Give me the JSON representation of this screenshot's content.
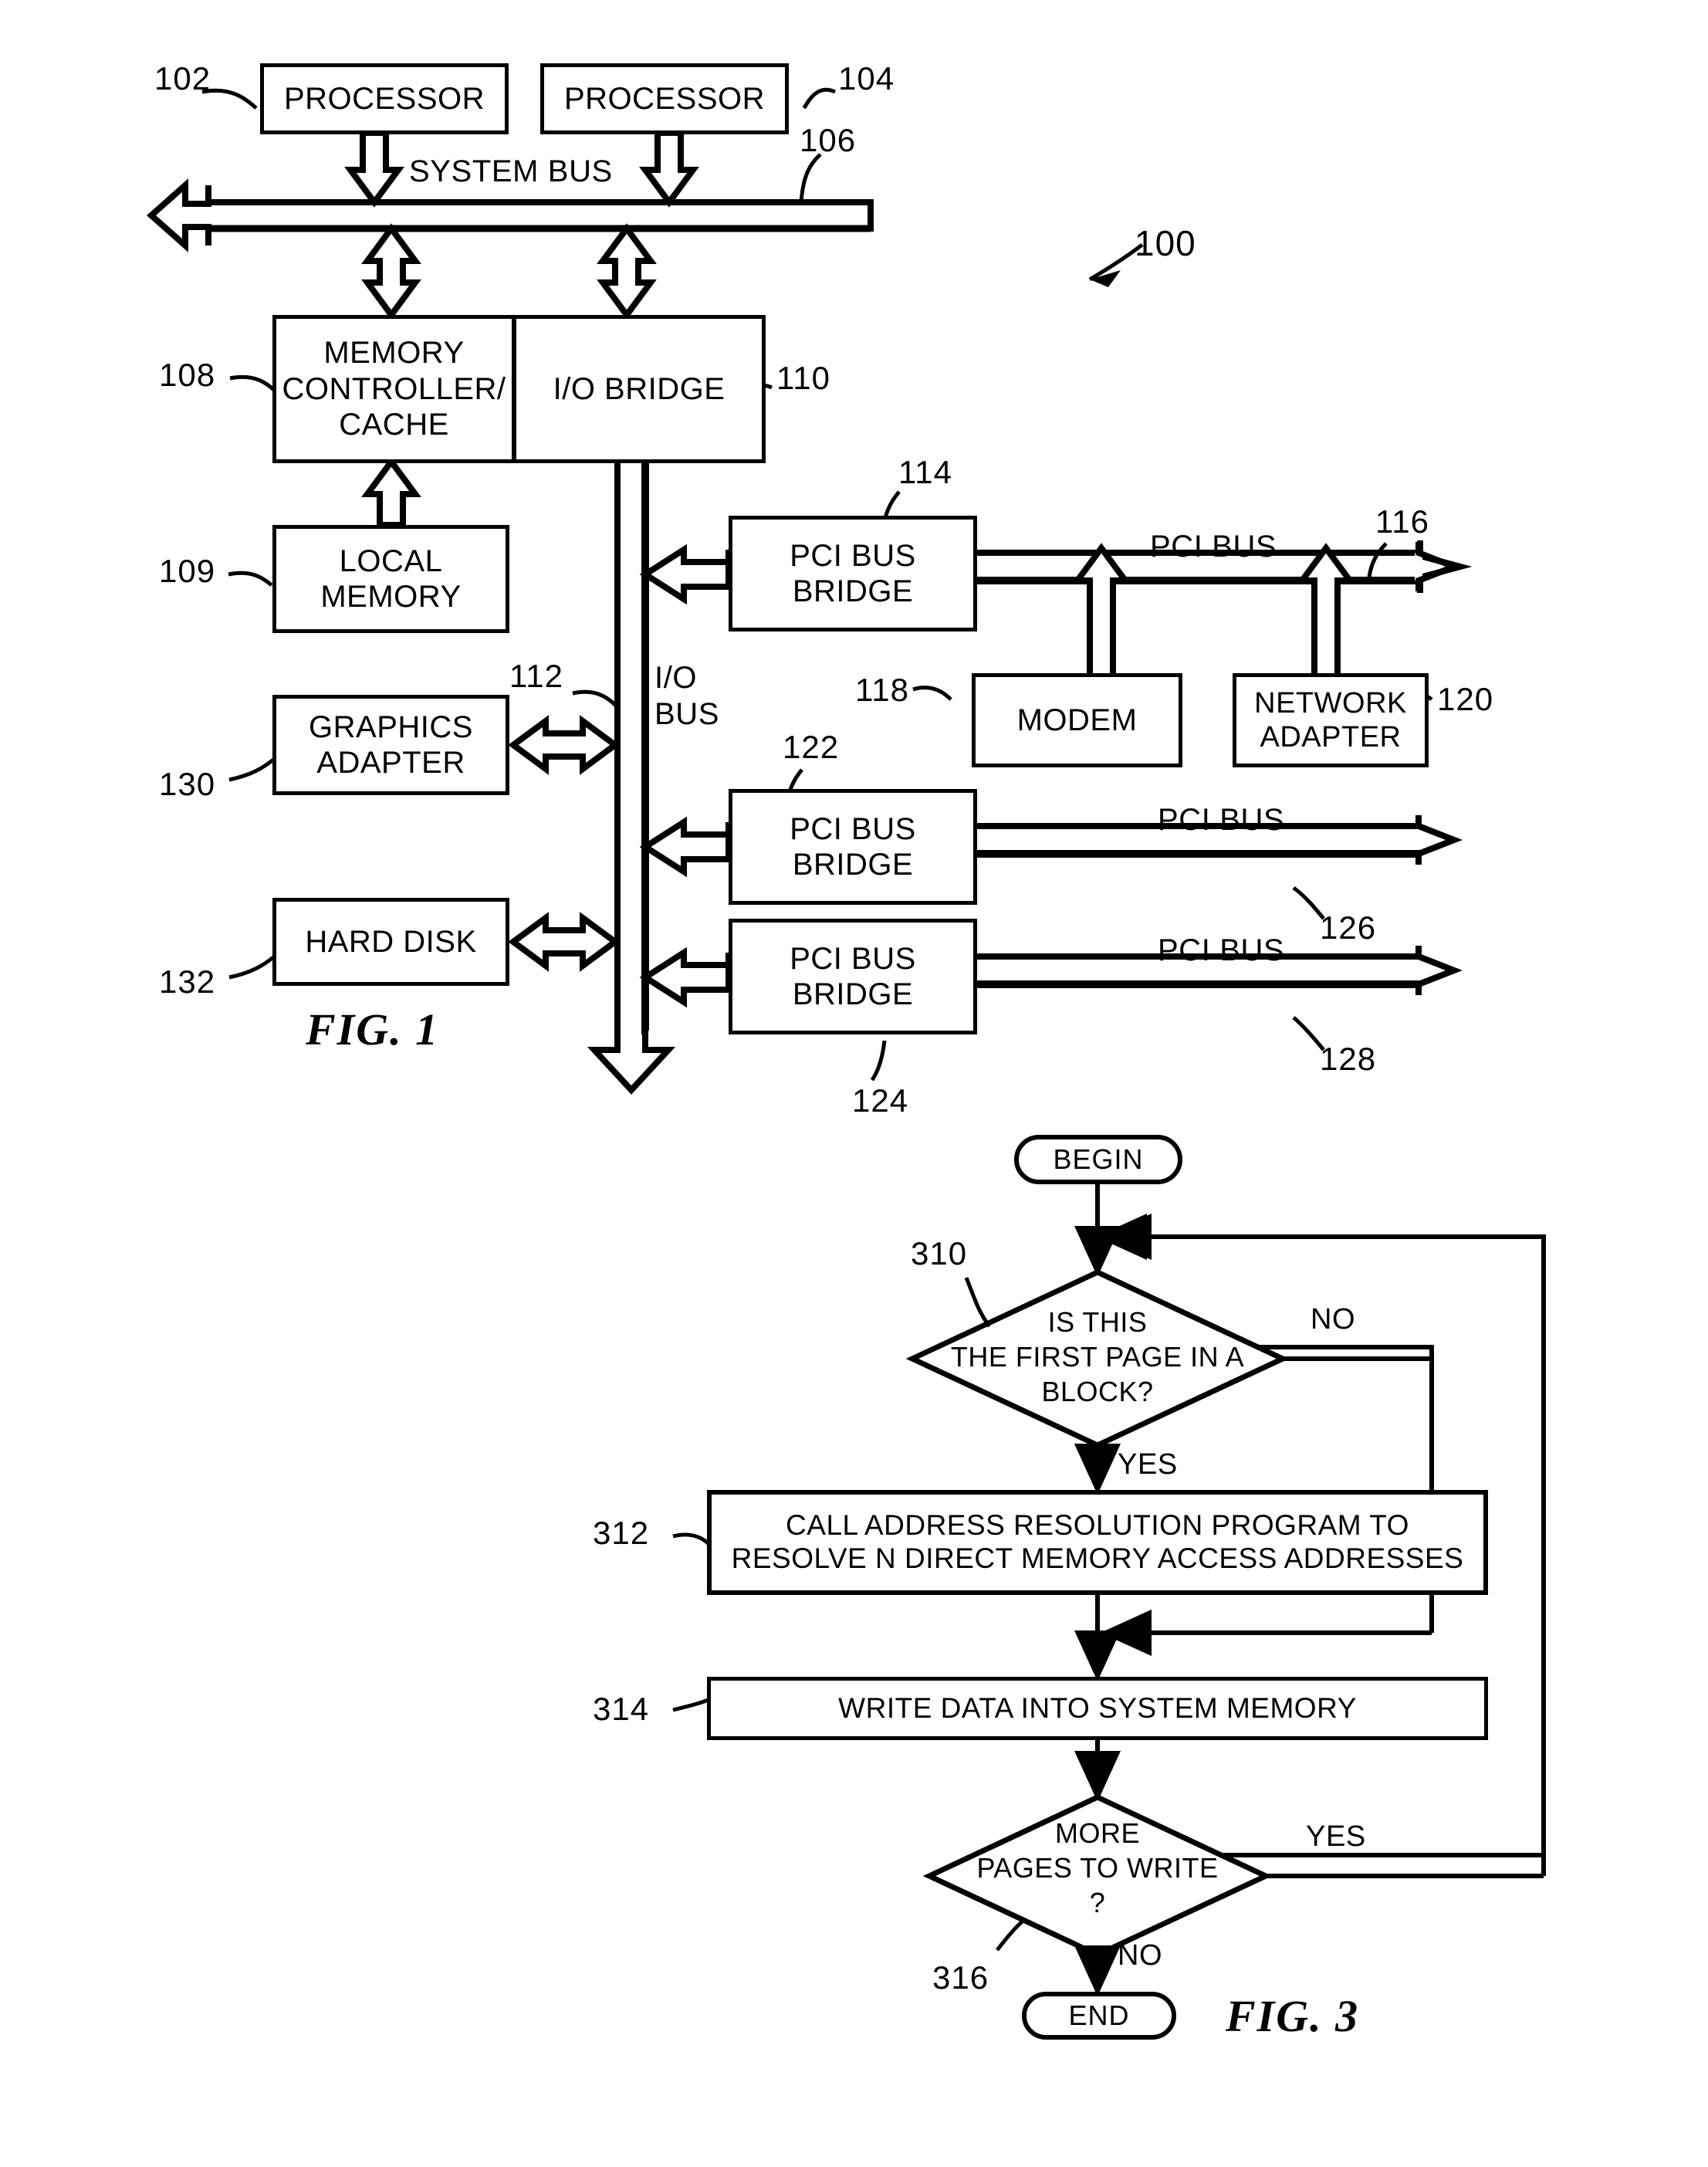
{
  "document": {
    "type": "patent-drawing-sheet",
    "figures": [
      "FIG. 1",
      "FIG. 3"
    ]
  },
  "fig1": {
    "caption": "FIG. 1",
    "system_ref": "100",
    "blocks": {
      "processor1": {
        "label": "PROCESSOR",
        "ref": "102"
      },
      "processor2": {
        "label": "PROCESSOR",
        "ref": "104"
      },
      "memory_controller": {
        "label": "MEMORY\nCONTROLLER/\nCACHE",
        "ref": "108"
      },
      "io_bridge": {
        "label": "I/O BRIDGE",
        "ref": "110"
      },
      "local_memory": {
        "label": "LOCAL\nMEMORY",
        "ref": "109"
      },
      "graphics_adapter": {
        "label": "GRAPHICS\nADAPTER",
        "ref": "130"
      },
      "hard_disk": {
        "label": "HARD DISK",
        "ref": "132"
      },
      "pci_bus_bridge_1": {
        "label": "PCI BUS\nBRIDGE",
        "ref": "114"
      },
      "pci_bus_bridge_2": {
        "label": "PCI BUS\nBRIDGE",
        "ref": "122"
      },
      "pci_bus_bridge_3": {
        "label": "PCI BUS\nBRIDGE",
        "ref": "124"
      },
      "modem": {
        "label": "MODEM",
        "ref": "118"
      },
      "network_adapter": {
        "label": "NETWORK\nADAPTER",
        "ref": "120"
      }
    },
    "buses": {
      "system_bus": {
        "label": "SYSTEM BUS",
        "ref": "106"
      },
      "io_bus": {
        "label": "I/O\nBUS",
        "ref": "112"
      },
      "pci_bus_1": {
        "label": "PCI BUS",
        "ref": "116"
      },
      "pci_bus_2": {
        "label": "PCI BUS",
        "ref": "126"
      },
      "pci_bus_3": {
        "label": "PCI BUS",
        "ref": "128"
      }
    }
  },
  "fig3": {
    "caption": "FIG. 3",
    "nodes": {
      "begin": {
        "label": "BEGIN"
      },
      "decision_first_page": {
        "label": "IS THIS\nTHE FIRST PAGE IN A\nBLOCK?",
        "ref": "310"
      },
      "call_address_resolution": {
        "label": "CALL ADDRESS RESOLUTION PROGRAM TO\nRESOLVE N DIRECT MEMORY ACCESS ADDRESSES",
        "ref": "312"
      },
      "write_data": {
        "label": "WRITE DATA INTO SYSTEM MEMORY",
        "ref": "314"
      },
      "decision_more_pages": {
        "label": "MORE\nPAGES TO WRITE\n?",
        "ref": "316"
      },
      "end": {
        "label": "END"
      }
    },
    "edge_labels": {
      "first_page_no": "NO",
      "first_page_yes": "YES",
      "more_pages_yes": "YES",
      "more_pages_no": "NO"
    }
  },
  "colors": {
    "ink": "#000000",
    "paper": "#ffffff"
  }
}
